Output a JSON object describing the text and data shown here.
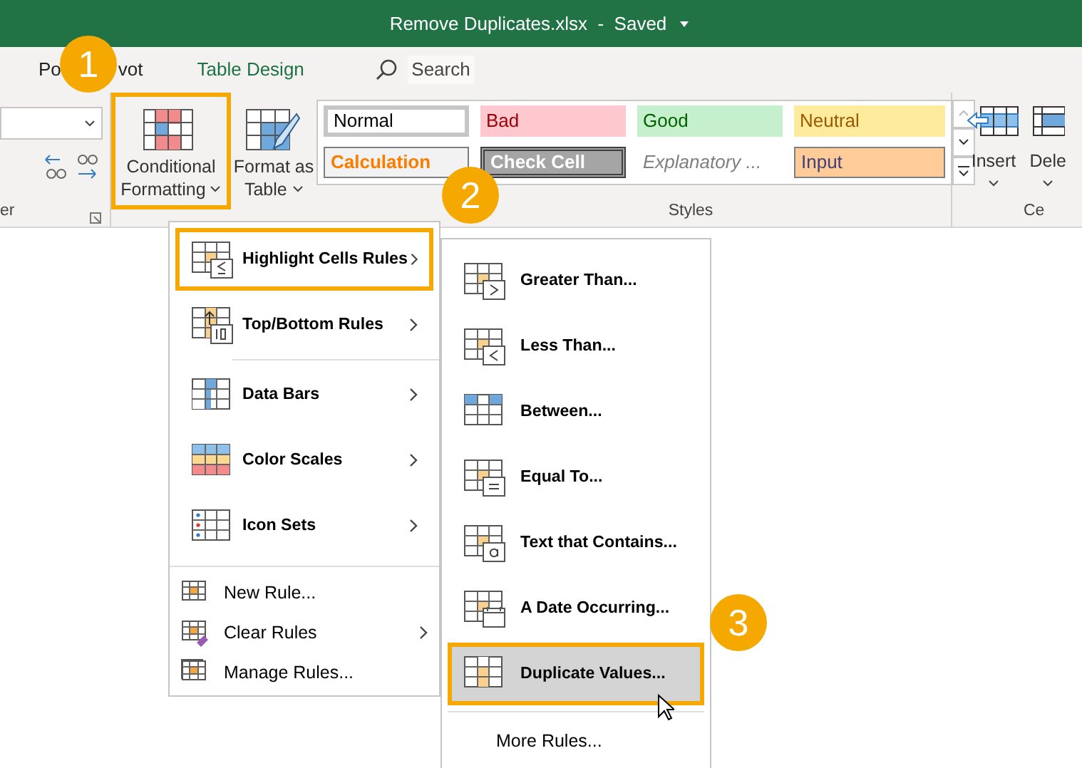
{
  "window": {
    "title": "Remove Duplicates.xlsx  -  Saved"
  },
  "tabs": [
    {
      "label_start": "Po",
      "label_end": "vot",
      "selected": false
    },
    {
      "label": "Table Design",
      "selected": true
    }
  ],
  "search": {
    "placeholder": "Search"
  },
  "ribbon": {
    "partial_group_label": "er",
    "buttons": [
      {
        "lines": [
          "Conditional",
          "Formatting"
        ],
        "highlighted": true
      },
      {
        "lines": [
          "Format as",
          "Table"
        ],
        "highlighted": false
      }
    ],
    "styles": {
      "label": "Styles",
      "scroll": [
        {
          "disabled": true
        },
        {
          "disabled": false
        },
        {
          "disabled": false
        }
      ],
      "cells": [
        {
          "label": "Normal",
          "kind": "normal"
        },
        {
          "label": "Bad",
          "kind": "bad"
        },
        {
          "label": "Good",
          "kind": "good"
        },
        {
          "label": "Neutral",
          "kind": "neutral"
        },
        {
          "label": "Calculation",
          "kind": "calculation"
        },
        {
          "label": "Check Cell",
          "kind": "check"
        },
        {
          "label": "Explanatory ...",
          "kind": "explanatory"
        },
        {
          "label": "Input",
          "kind": "input"
        }
      ]
    },
    "cells_group": {
      "label": "Ce",
      "buttons": [
        "Insert",
        "Dele"
      ]
    }
  },
  "menu": {
    "items": [
      {
        "label": "Highlight Cells Rules",
        "kind": "large",
        "submenu": true,
        "highlighted": true
      },
      {
        "label": "Top/Bottom Rules",
        "kind": "large",
        "submenu": true,
        "highlighted": false
      },
      {
        "label": "Data Bars",
        "kind": "large",
        "submenu": true,
        "highlighted": false
      },
      {
        "label": "Color Scales",
        "kind": "large",
        "submenu": true,
        "highlighted": false
      },
      {
        "label": "Icon Sets",
        "kind": "large",
        "submenu": true,
        "highlighted": false
      },
      {
        "label": "New Rule...",
        "kind": "small",
        "submenu": false,
        "highlighted": false
      },
      {
        "label": "Clear Rules",
        "kind": "small",
        "submenu": true,
        "highlighted": false
      },
      {
        "label": "Manage Rules...",
        "kind": "small",
        "submenu": false,
        "highlighted": false
      }
    ]
  },
  "submenu": {
    "items": [
      {
        "label": "Greater Than...",
        "highlighted": false,
        "hovered": false
      },
      {
        "label": "Less Than...",
        "highlighted": false,
        "hovered": false
      },
      {
        "label": "Between...",
        "highlighted": false,
        "hovered": false
      },
      {
        "label": "Equal To...",
        "highlighted": false,
        "hovered": false
      },
      {
        "label": "Text that Contains...",
        "highlighted": false,
        "hovered": false
      },
      {
        "label": "A Date Occurring...",
        "highlighted": false,
        "hovered": false
      },
      {
        "label": "Duplicate Values...",
        "highlighted": true,
        "hovered": true
      }
    ],
    "footer": "More Rules..."
  },
  "badges": [
    "1",
    "2",
    "3"
  ]
}
